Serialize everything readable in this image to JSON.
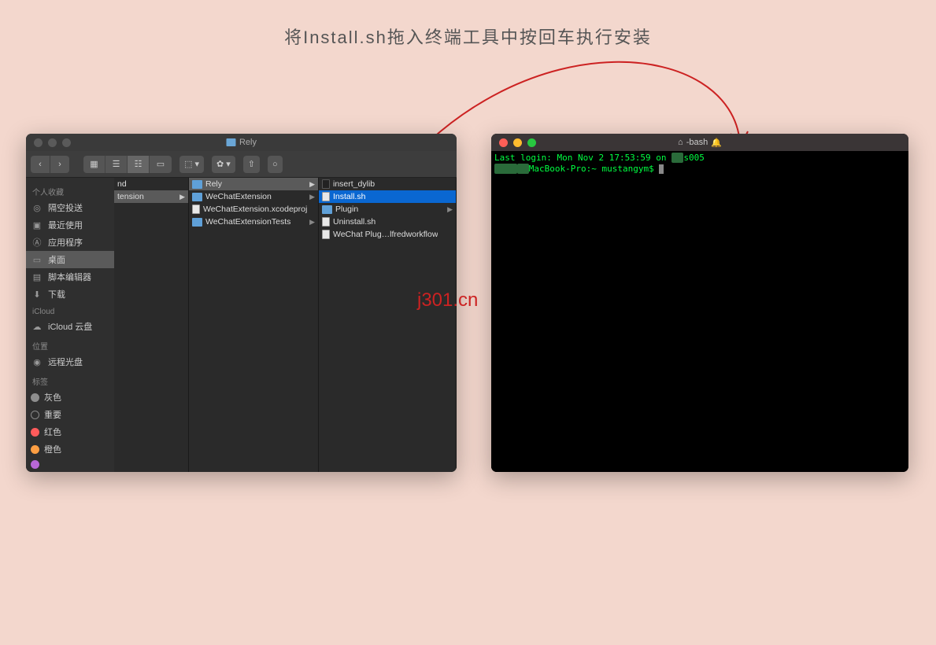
{
  "instruction": "将Install.sh拖入终端工具中按回车执行安装",
  "watermark": "j301.cn",
  "finder": {
    "title": "Rely",
    "sidebar": {
      "favorites_label": "个人收藏",
      "favorites": [
        {
          "icon": "airdrop",
          "label": "隔空投送"
        },
        {
          "icon": "recents",
          "label": "最近使用"
        },
        {
          "icon": "apps",
          "label": "应用程序"
        },
        {
          "icon": "desktop",
          "label": "桌面",
          "selected": true
        },
        {
          "icon": "scripts",
          "label": "脚本编辑器"
        },
        {
          "icon": "downloads",
          "label": "下载"
        }
      ],
      "icloud_label": "iCloud",
      "icloud": [
        {
          "icon": "cloud",
          "label": "iCloud 云盘"
        }
      ],
      "locations_label": "位置",
      "locations": [
        {
          "icon": "disc",
          "label": "远程光盘"
        }
      ],
      "tags_label": "标签",
      "tags": [
        {
          "color": "#8e8e8e",
          "label": "灰色"
        },
        {
          "color": "transparent",
          "label": "重要",
          "outline": true
        },
        {
          "color": "#ff5b5b",
          "label": "红色"
        },
        {
          "color": "#ff9f43",
          "label": "橙色"
        },
        {
          "color": "#b867d6",
          "label": ""
        }
      ]
    },
    "column1": [
      {
        "label": "nd"
      },
      {
        "label": "tension",
        "selected": true,
        "arrow": true
      }
    ],
    "column2": [
      {
        "icon": "folder",
        "label": "Rely",
        "selected": true,
        "arrow": true
      },
      {
        "icon": "folder",
        "label": "WeChatExtension",
        "arrow": true
      },
      {
        "icon": "file",
        "label": "WeChatExtension.xcodeproj"
      },
      {
        "icon": "folder",
        "label": "WeChatExtensionTests",
        "arrow": true
      }
    ],
    "column3": [
      {
        "icon": "shell",
        "label": "insert_dylib"
      },
      {
        "icon": "file",
        "label": "Install.sh",
        "highlight": true
      },
      {
        "icon": "folder",
        "label": "Plugin",
        "arrow": true
      },
      {
        "icon": "file",
        "label": "Uninstall.sh"
      },
      {
        "icon": "file",
        "label": "WeChat Plug…lfredworkflow"
      }
    ]
  },
  "terminal": {
    "title": "-bash",
    "line1_prefix": "Last login: Mon Nov  2 17:53:59 on ",
    "line1_suffix": "s005",
    "line2_host": "MacBook-Pro:~ mustangym$"
  }
}
